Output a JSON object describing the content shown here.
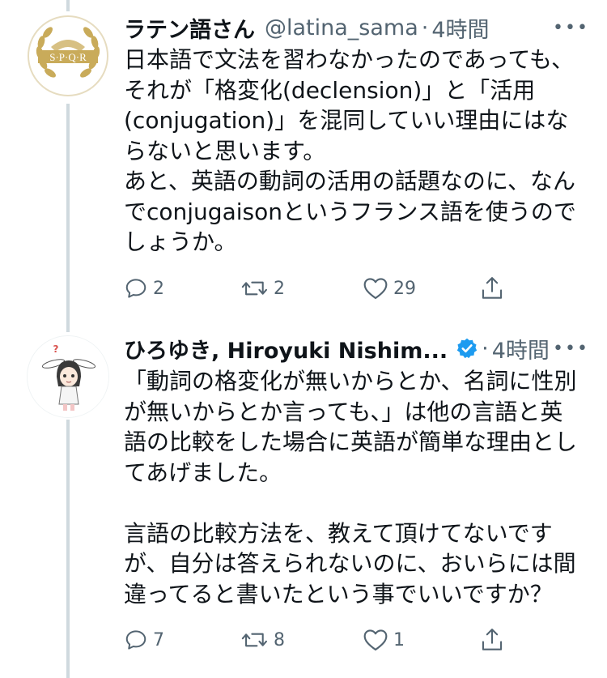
{
  "tweets": [
    {
      "name": "ラテン語さん",
      "handle": "@latina_sama",
      "dot": "·",
      "time": "4時間",
      "avatar_text": "S·P·Q·R",
      "text": "日本語で文法を習わなかったのであっても、\nそれが「格変化(declension)」と「活用\n(conjugation)」を混同していい理由にはな\nらないと思います。\nあと、英語の動詞の活用の話題なのに、なん\nでconjugaisonというフランス語を使うので\nしょうか。",
      "replies": "2",
      "retweets": "2",
      "likes": "29"
    },
    {
      "name": "ひろゆき, Hiroyuki Nishim...",
      "handle": "",
      "dot": "·",
      "time": "4時間",
      "avatar_text": "?",
      "text": "「動詞の格変化が無いからとか、名詞に性別\nが無いからとか言っても、」は他の言語と英\n語の比較をした場合に英語が簡単な理由とし\nてあげました。\n\n言語の比較方法を、教えて頂けてないです\nが、自分は答えられないのに、おいらには間\n違ってると書いたという事でいいですか？",
      "replies": "7",
      "retweets": "8",
      "likes": "1"
    }
  ],
  "colors": {
    "text": "#0f1419",
    "secondary": "#536471",
    "verified": "#1d9bf0",
    "thread_line": "#cfd9de",
    "gold": "#c9ab5a"
  },
  "icons": [
    "reply-icon",
    "retweet-icon",
    "like-icon",
    "share-icon",
    "verified-icon",
    "more-icon"
  ]
}
